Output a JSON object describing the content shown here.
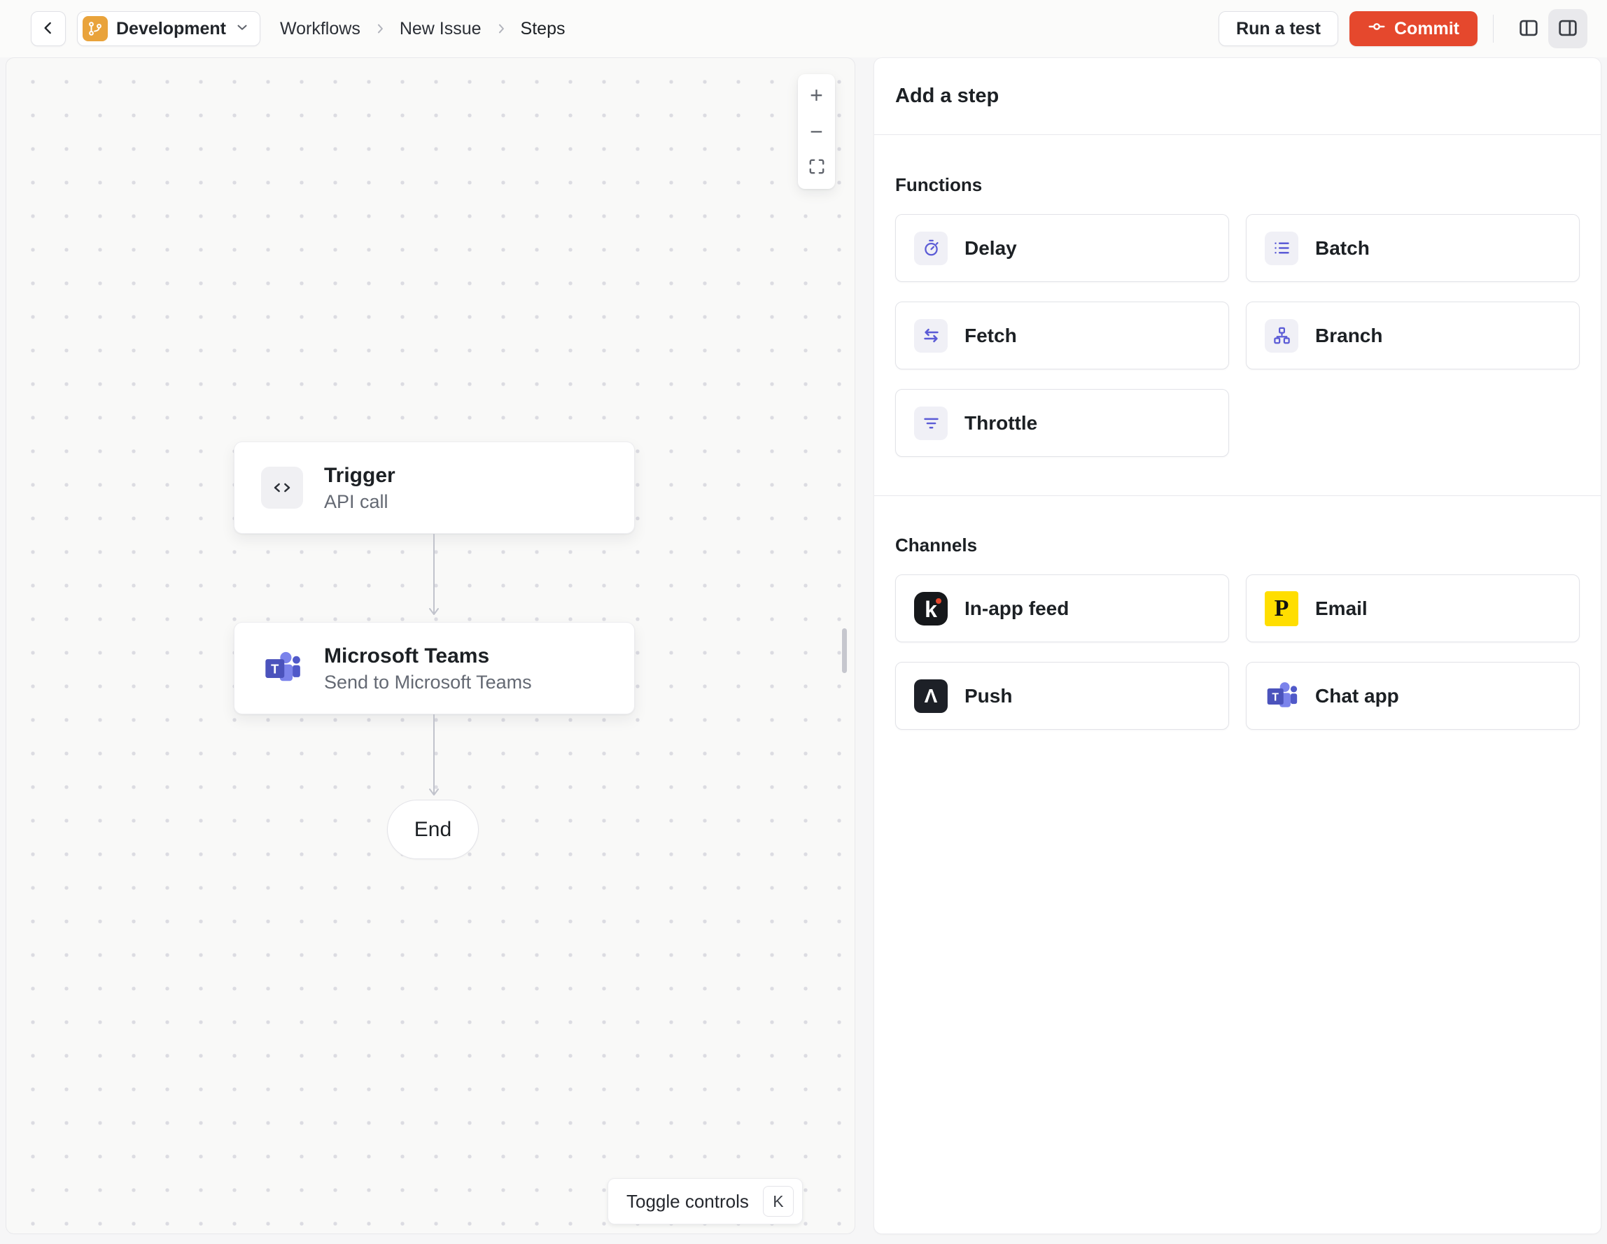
{
  "header": {
    "environment": {
      "label": "Development"
    },
    "breadcrumb": [
      "Workflows",
      "New Issue",
      "Steps"
    ],
    "run_test_label": "Run a test",
    "commit_label": "Commit"
  },
  "canvas": {
    "nodes": [
      {
        "title": "Trigger",
        "subtitle": "API call",
        "icon": "code-icon"
      },
      {
        "title": "Microsoft Teams",
        "subtitle": "Send to Microsoft Teams",
        "icon": "microsoft-teams-icon"
      }
    ],
    "end_label": "End",
    "controls": {
      "zoom_in": "+",
      "zoom_out": "−"
    },
    "toggle_controls": {
      "label": "Toggle controls",
      "shortcut": "K"
    }
  },
  "panel": {
    "title": "Add a step",
    "functions": {
      "heading": "Functions",
      "items": [
        {
          "label": "Delay",
          "icon": "timer-icon"
        },
        {
          "label": "Batch",
          "icon": "batch-list-icon"
        },
        {
          "label": "Fetch",
          "icon": "swap-arrows-icon"
        },
        {
          "label": "Branch",
          "icon": "branch-tree-icon"
        },
        {
          "label": "Throttle",
          "icon": "throttle-filter-icon"
        }
      ]
    },
    "channels": {
      "heading": "Channels",
      "items": [
        {
          "label": "In-app feed",
          "icon": "knock-icon",
          "glyph": "k"
        },
        {
          "label": "Email",
          "icon": "postmark-icon",
          "glyph": "P"
        },
        {
          "label": "Push",
          "icon": "expo-icon",
          "glyph": "Λ"
        },
        {
          "label": "Chat app",
          "icon": "microsoft-teams-icon",
          "glyph": "T"
        }
      ]
    }
  },
  "colors": {
    "commit_accent": "#E5482D",
    "environment_badge": "#E9A33B",
    "function_icon": "#5B5BD6",
    "knock_black": "#16181B",
    "postmark_yellow": "#FFDE00",
    "expo_dark": "#1D2027",
    "teams_purple": "#4B53BC",
    "canvas_dot": "#DCDCE2"
  }
}
